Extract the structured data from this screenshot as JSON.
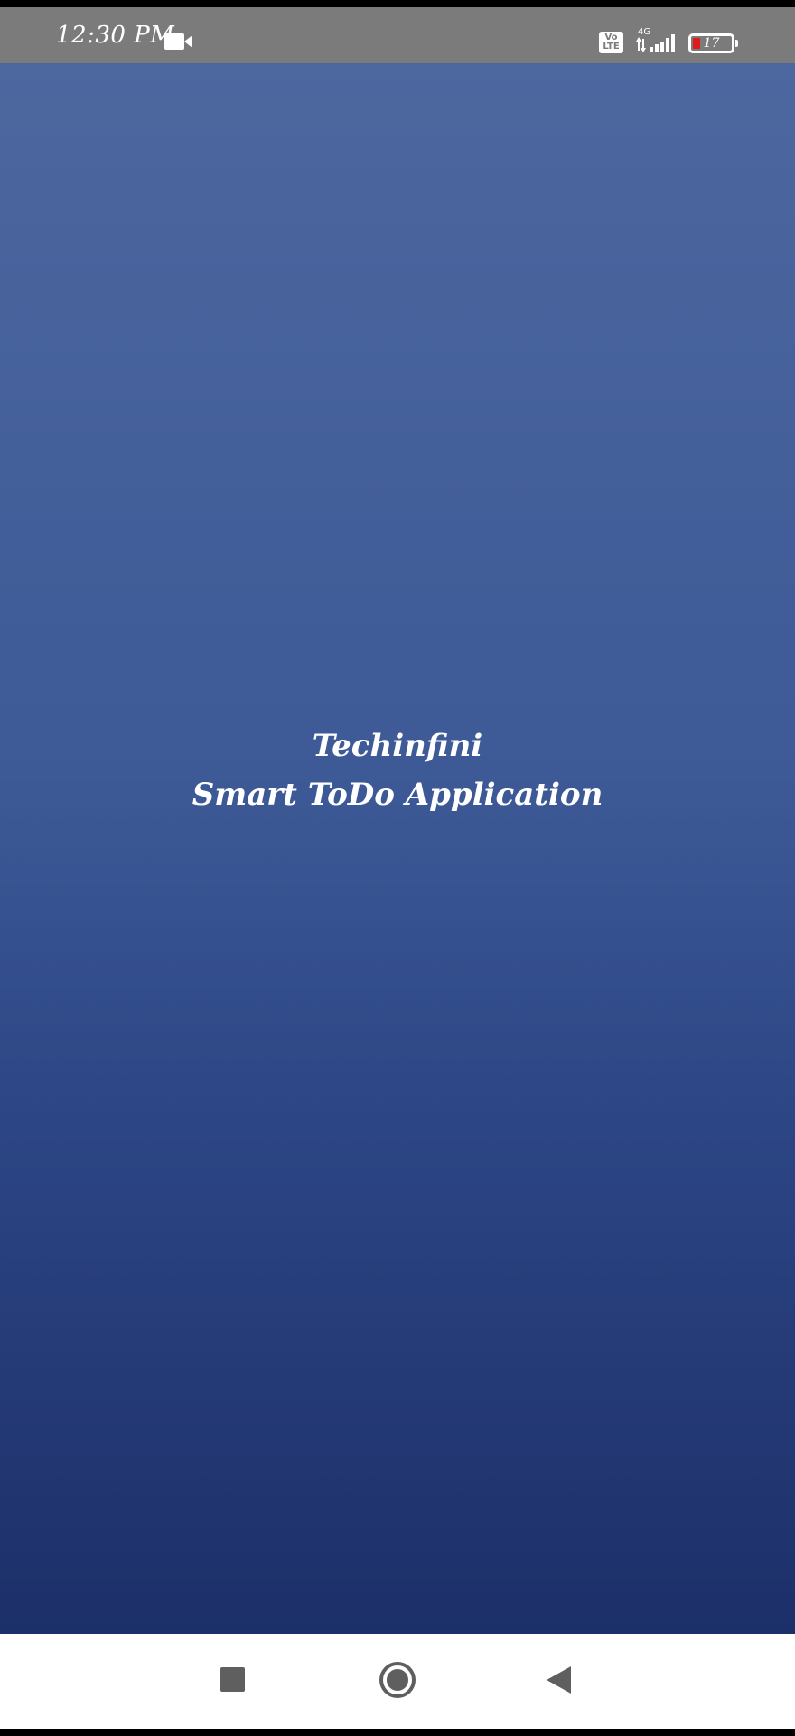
{
  "status_bar": {
    "time": "12:30 PM",
    "video_icon": "video-camera-icon",
    "volte_top": "Vo",
    "volte_bottom": "LTE",
    "network_type": "4G",
    "signal_icon": "signal-bars-icon",
    "battery_level": "17",
    "battery_color": "#e0191b"
  },
  "splash": {
    "line1": "Techinfini",
    "line2": "Smart ToDo Application"
  },
  "nav_bar": {
    "recents_icon": "square-icon",
    "home_icon": "circle-icon",
    "back_icon": "triangle-back-icon"
  },
  "colors": {
    "status_bar_bg": "#7b7b7b",
    "gradient_top": "#4d679f",
    "gradient_bottom": "#1c2f69",
    "nav_bar_bg": "#ffffff",
    "nav_icon": "#5f5f5f"
  }
}
